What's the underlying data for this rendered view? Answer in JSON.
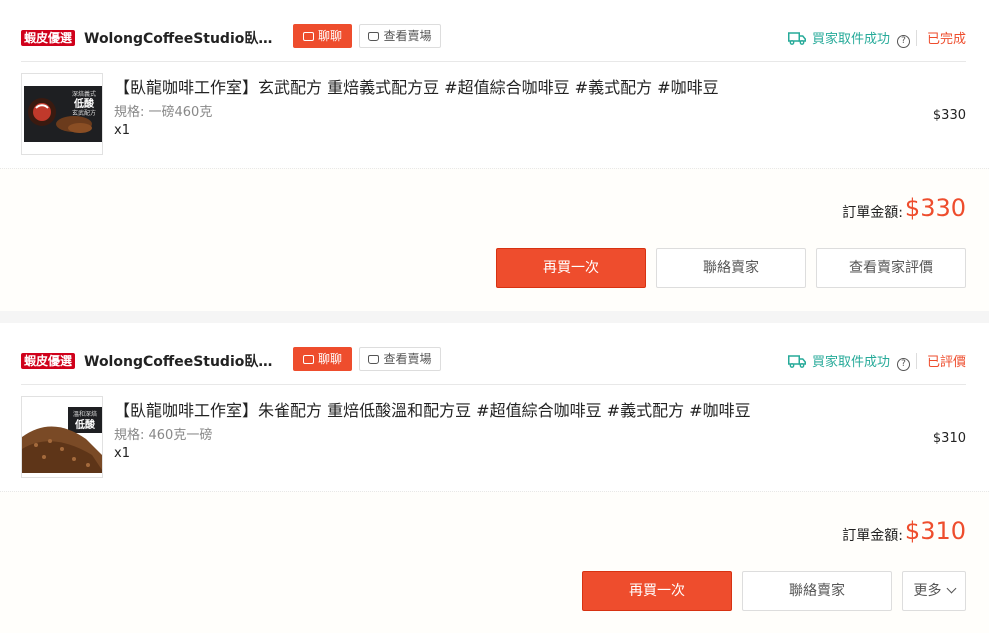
{
  "orders": [
    {
      "badge": "蝦皮優選",
      "shop_name": "WolongCoffeeStudio臥龍咖啡工作室",
      "chat_label": "聊聊",
      "view_shop_label": "查看賣場",
      "delivery_status": "買家取件成功",
      "order_state": "已完成",
      "product": {
        "title": "【臥龍咖啡工作室】玄武配方 重焙義式配方豆 #超值綜合咖啡豆 #義式配方 #咖啡豆",
        "spec": "規格: 一磅460克",
        "qty": "x1",
        "price": "$330",
        "thumb_label_small": "深焙義式",
        "thumb_label_big": "低酸",
        "thumb_label_sub": "玄武配方"
      },
      "total_label": "訂單金額:",
      "total_value": "$330",
      "actions": [
        "再買一次",
        "聯絡賣家",
        "查看賣家評價"
      ]
    },
    {
      "badge": "蝦皮優選",
      "shop_name": "WolongCoffeeStudio臥龍咖啡工作室",
      "chat_label": "聊聊",
      "view_shop_label": "查看賣場",
      "delivery_status": "買家取件成功",
      "order_state": "已評價",
      "product": {
        "title": "【臥龍咖啡工作室】朱雀配方 重焙低酸溫和配方豆 #超值綜合咖啡豆 #義式配方 #咖啡豆",
        "spec": "規格: 460克一磅",
        "qty": "x1",
        "price": "$310",
        "thumb_label_small": "溫和深焙",
        "thumb_label_big": "低酸",
        "thumb_label_sub": ""
      },
      "total_label": "訂單金額:",
      "total_value": "$310",
      "actions": [
        "再買一次",
        "聯絡賣家",
        "更多"
      ]
    }
  ],
  "colors": {
    "accent": "#ee4d2d",
    "delivery": "#26aa99",
    "badge": "#d0011b"
  }
}
